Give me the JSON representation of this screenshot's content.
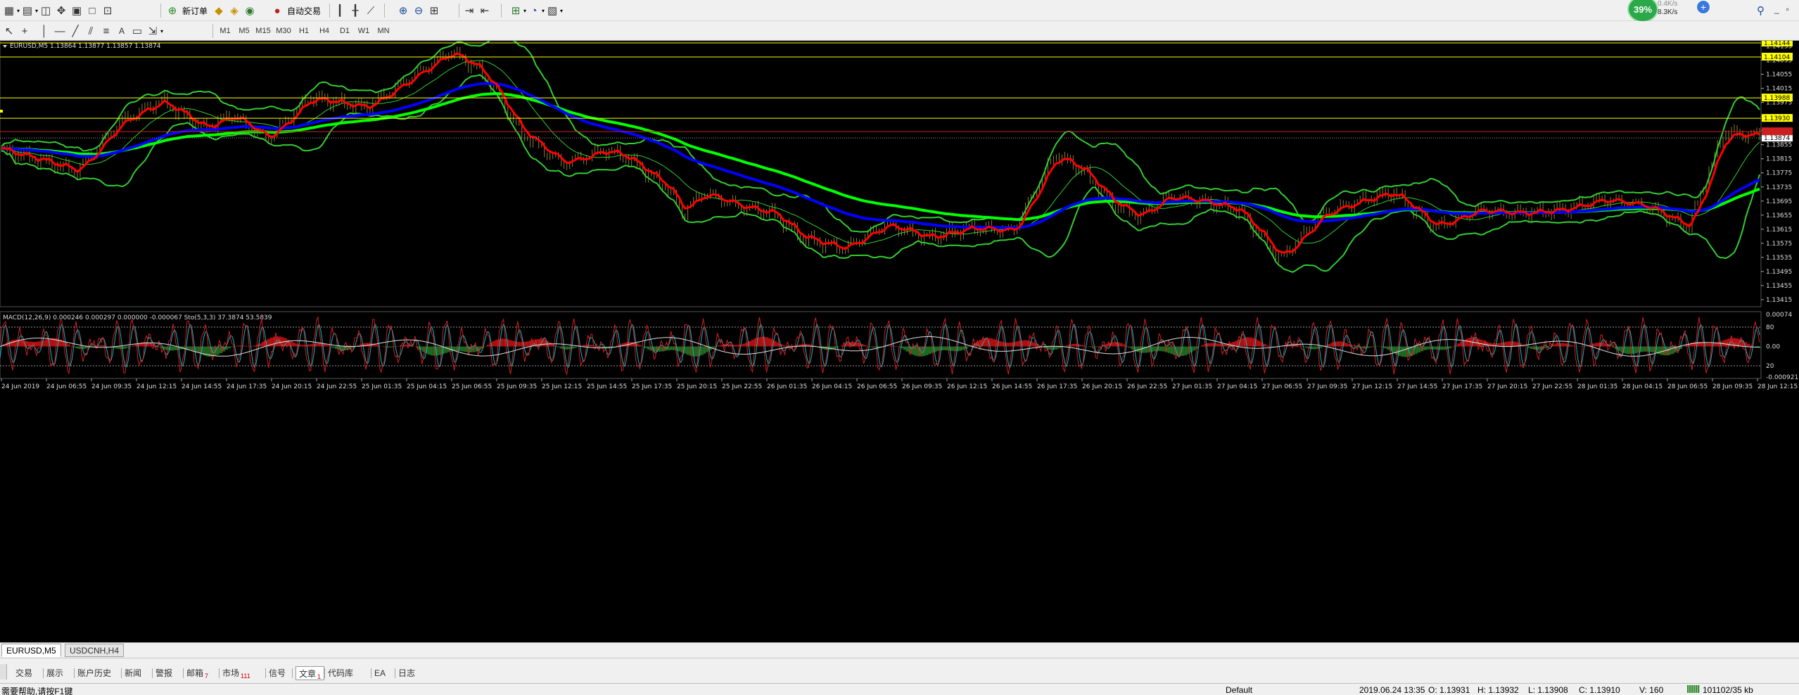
{
  "toolbar": {
    "new_order": "新订单",
    "auto_trading": "自动交易",
    "timeframes": [
      "M1",
      "M5",
      "M15",
      "M30",
      "H1",
      "H4",
      "D1",
      "W1",
      "MN"
    ]
  },
  "system_tray": {
    "net_percent": "39%",
    "net_down": "0.4K/s",
    "net_up": "8.3K/s"
  },
  "chart": {
    "title": "EURUSD,M5  1.13864 1.13877 1.13857 1.13874",
    "indicator_label": "MACD(12,26,9) 0.000246 0.000297 0.000000 -0.000067  Sto(5,3,3) 37.3874 53.5839",
    "price_ticks": [
      "1.14135",
      "1.14095",
      "1.14055",
      "1.14015",
      "1.13975",
      "1.13935",
      "1.13895",
      "1.13855",
      "1.13815",
      "1.13775",
      "1.13735",
      "1.13695",
      "1.13655",
      "1.13615",
      "1.13575",
      "1.13535",
      "1.13495",
      "1.13455",
      "1.13415"
    ],
    "price_tags": [
      "1.14144",
      "1.14104",
      "1.13988",
      "1.13930",
      "1.13874"
    ],
    "sub_ticks": [
      "0.00074",
      "80",
      "0.00",
      "20",
      "-0.000921"
    ],
    "time_ticks": [
      "24 Jun 2019",
      "24 Jun 06:55",
      "24 Jun 09:35",
      "24 Jun 12:15",
      "24 Jun 14:55",
      "24 Jun 17:35",
      "24 Jun 20:15",
      "24 Jun 22:55",
      "25 Jun 01:35",
      "25 Jun 04:15",
      "25 Jun 06:55",
      "25 Jun 09:35",
      "25 Jun 12:15",
      "25 Jun 14:55",
      "25 Jun 17:35",
      "25 Jun 20:15",
      "25 Jun 22:55",
      "26 Jun 01:35",
      "26 Jun 04:15",
      "26 Jun 06:55",
      "26 Jun 09:35",
      "26 Jun 12:15",
      "26 Jun 14:55",
      "26 Jun 17:35",
      "26 Jun 20:15",
      "26 Jun 22:55",
      "27 Jun 01:35",
      "27 Jun 04:15",
      "27 Jun 06:55",
      "27 Jun 09:35",
      "27 Jun 12:15",
      "27 Jun 14:55",
      "27 Jun 17:35",
      "27 Jun 20:15",
      "27 Jun 22:55",
      "28 Jun 01:35",
      "28 Jun 04:15",
      "28 Jun 06:55",
      "28 Jun 09:35",
      "28 Jun 12:15"
    ],
    "colors": {
      "background": "#000000",
      "bollinger": "#32cd32",
      "ma_fast": "#ff0000",
      "ma_slow": "#0000ff",
      "ma_long": "#00ff00",
      "hline": "#ffff00",
      "candle": "#8b7d3a"
    }
  },
  "chart_tabs": [
    "EURUSD,M5",
    "USDCNH,H4"
  ],
  "terminal_tabs": [
    {
      "label": "交易",
      "badge": ""
    },
    {
      "label": "展示",
      "badge": ""
    },
    {
      "label": "账户历史",
      "badge": ""
    },
    {
      "label": "新闻",
      "badge": ""
    },
    {
      "label": "警报",
      "badge": ""
    },
    {
      "label": "邮箱",
      "badge": "7"
    },
    {
      "label": "市场",
      "badge": "111"
    },
    {
      "label": "信号",
      "badge": ""
    },
    {
      "label": "文章",
      "badge": "1"
    },
    {
      "label": "代码库",
      "badge": ""
    },
    {
      "label": "EA",
      "badge": ""
    },
    {
      "label": "日志",
      "badge": ""
    }
  ],
  "status_bar": {
    "help": "需要帮助,请按F1键",
    "profile": "Default",
    "datetime": "2019.06.24 13:35",
    "open": "O: 1.13931",
    "high": "H: 1.13932",
    "low": "L: 1.13908",
    "close": "C: 1.13910",
    "volume": "V: 160",
    "traffic": "101102/35 kb"
  }
}
